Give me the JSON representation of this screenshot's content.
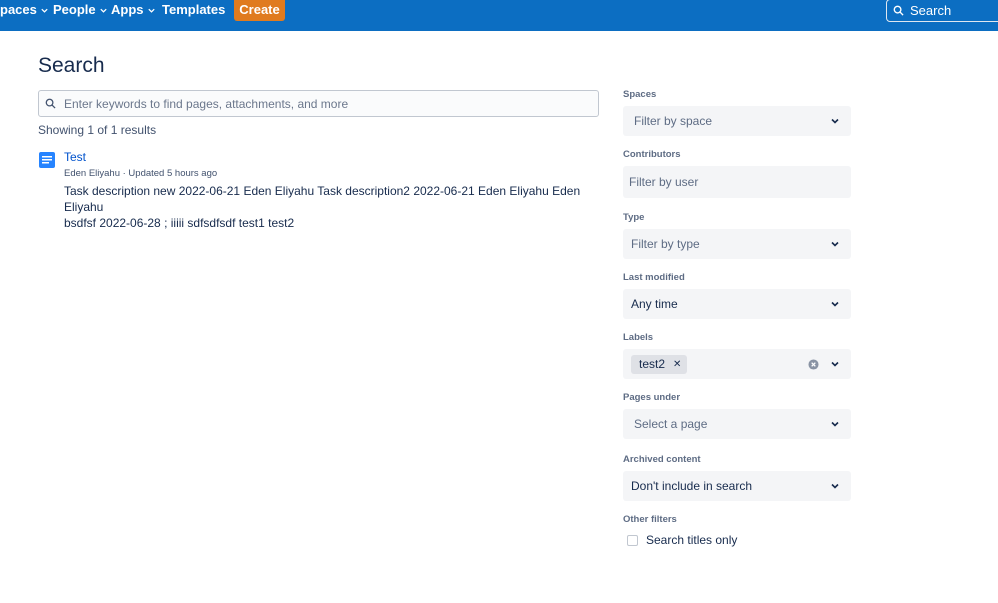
{
  "nav": {
    "spaces_label": "paces",
    "people_label": "People",
    "apps_label": "Apps",
    "templates_label": "Templates",
    "create_label": "Create",
    "search_label": "Search"
  },
  "main": {
    "title": "Search",
    "search_placeholder": "Enter keywords to find pages, attachments, and more",
    "results_count": "Showing 1 of 1 results",
    "results": [
      {
        "title": "Test",
        "meta": "Eden Eliyahu · Updated 5 hours ago",
        "snippet_line1": "Task description new 2022-06-21 Eden Eliyahu Task description2 2022-06-21 Eden Eliyahu Eden Eliyahu",
        "snippet_line2": "bsdfsf 2022-06-28 ; iiiii sdfsdfsdf test1 test2"
      }
    ]
  },
  "filters": {
    "spaces": {
      "label": "Spaces",
      "value": "Filter by space"
    },
    "contributors": {
      "label": "Contributors",
      "value": "Filter by user"
    },
    "type": {
      "label": "Type",
      "value": "Filter by type"
    },
    "last_modified": {
      "label": "Last modified",
      "value": "Any time"
    },
    "labels": {
      "label": "Labels",
      "tags": [
        "test2"
      ]
    },
    "pages_under": {
      "label": "Pages under",
      "value": "Select a page"
    },
    "archived": {
      "label": "Archived content",
      "value": "Don't include in search"
    },
    "other": {
      "label": "Other filters",
      "titles_only_label": "Search titles only",
      "titles_only_checked": false
    }
  },
  "colors": {
    "nav_bg": "#0c6ec2",
    "create_bg": "#e07b1f",
    "link": "#0052cc",
    "filter_bg": "#f4f5f7"
  }
}
